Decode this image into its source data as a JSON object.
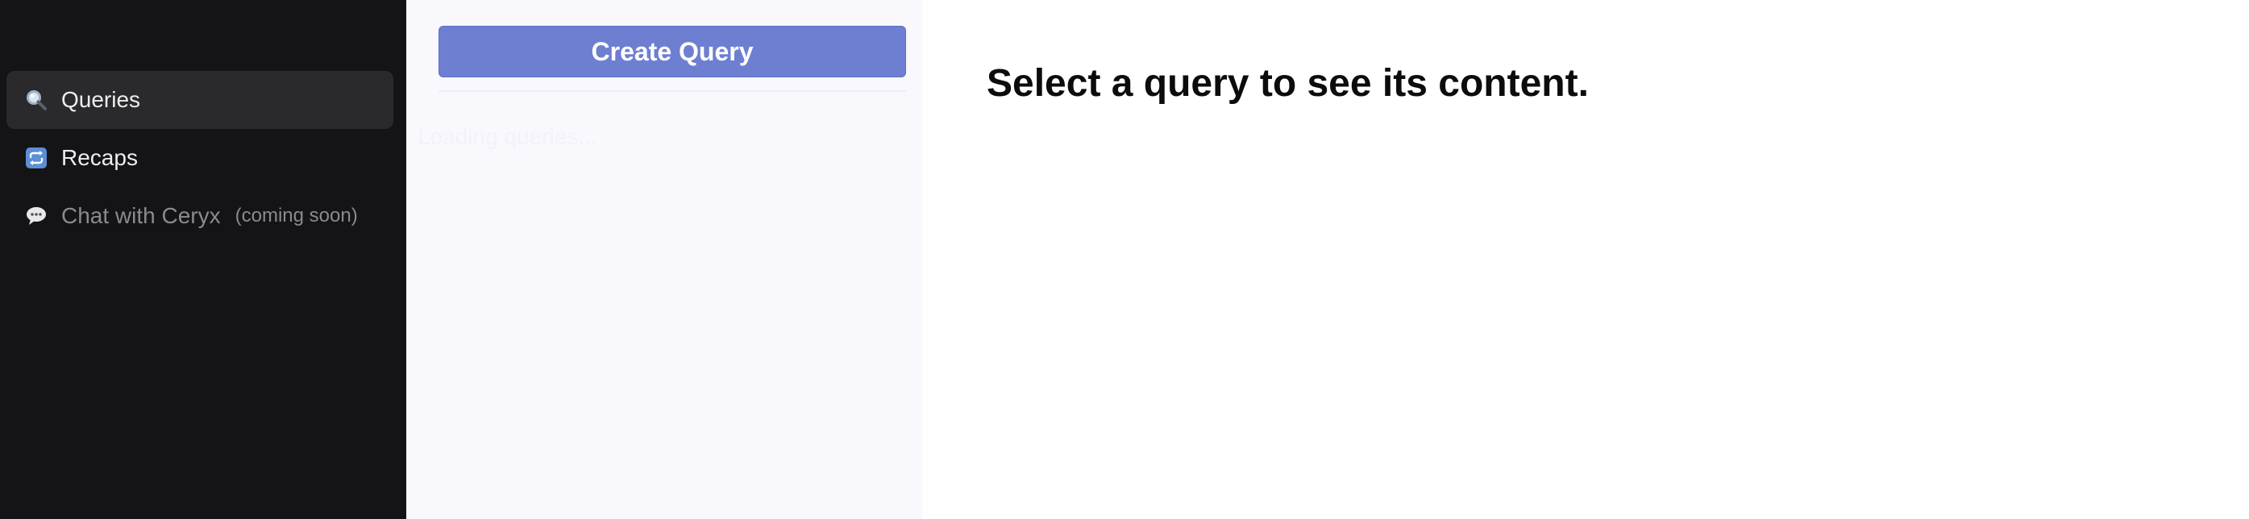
{
  "sidebar": {
    "items": [
      {
        "label": "Queries",
        "icon": "magnifier-icon",
        "active": true
      },
      {
        "label": "Recaps",
        "icon": "repeat-icon",
        "active": false
      },
      {
        "label": "Chat with Ceryx",
        "icon": "speech-bubble-icon",
        "note": "(coming soon)",
        "disabled": true
      }
    ]
  },
  "queries_panel": {
    "create_label": "Create Query",
    "loading_text": "Loading queries..."
  },
  "main": {
    "title": "Select a query to see its content."
  },
  "colors": {
    "sidebar_bg": "#141416",
    "active_item_bg": "#2a2a2d",
    "panel_bg": "#f8f8fd",
    "accent": "#6e7fd2"
  }
}
